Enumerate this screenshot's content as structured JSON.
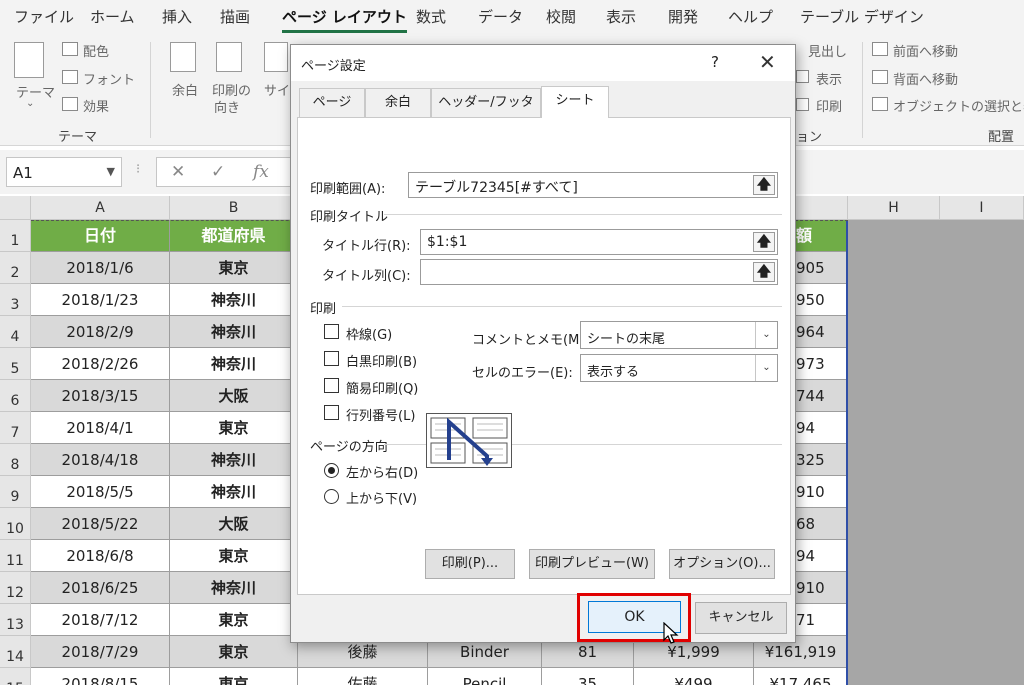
{
  "ribbon_tabs": [
    "ファイル",
    "ホーム",
    "挿入",
    "描画",
    "ページ レイアウト",
    "数式",
    "データ",
    "校閲",
    "表示",
    "開発",
    "ヘルプ",
    "テーブル デザイン"
  ],
  "active_tab_index": 4,
  "ribbon": {
    "theme_btn": "テーマ",
    "colors": "配色",
    "fonts": "フォント",
    "effects": "効果",
    "theme_group": "テーマ",
    "margins": "余白",
    "orientation_1": "印刷の",
    "orientation_2": "向き",
    "size": "サイズ",
    "headings": "見出し",
    "view": "表示",
    "print": "印刷",
    "sheet_options_group": "ョン",
    "bring_forward": "前面へ移動",
    "send_backward": "背面へ移動",
    "selection_pane": "オブジェクトの選択と表示",
    "arrange_group": "配置"
  },
  "formula_bar": {
    "name_box": "A1",
    "fx": "fx",
    "cancel": "✕",
    "enter": "✓"
  },
  "columns": [
    "A",
    "B",
    "H",
    "I"
  ],
  "rows": [
    "1",
    "2",
    "3",
    "4",
    "5",
    "6",
    "7",
    "8",
    "9",
    "10",
    "11",
    "12",
    "13",
    "14",
    "15"
  ],
  "table": {
    "headers": [
      "日付",
      "都道府県"
    ],
    "header_tail": "額",
    "dates": [
      "2018/1/6",
      "2018/1/23",
      "2018/2/9",
      "2018/2/26",
      "2018/3/15",
      "2018/4/1",
      "2018/4/18",
      "2018/5/5",
      "2018/5/22",
      "2018/6/8",
      "2018/6/25",
      "2018/7/12",
      "2018/7/29",
      "2018/8/15"
    ],
    "prefectures": [
      "東京",
      "神奈川",
      "神奈川",
      "神奈川",
      "大阪",
      "東京",
      "神奈川",
      "神奈川",
      "大阪",
      "東京",
      "神奈川",
      "東京",
      "東京",
      "東京"
    ],
    "amount_tails": [
      "905",
      "950",
      "964",
      "973",
      "744",
      "94",
      "325",
      "910",
      "68",
      "94",
      "910",
      "71"
    ],
    "row14": {
      "name": "後藤",
      "item": "Binder",
      "qty": "81",
      "price": "¥1,999",
      "amount": "¥161,919"
    },
    "row15": {
      "name": "佐藤",
      "item": "Pencil",
      "qty": "35",
      "price": "¥499",
      "amount": "¥17,465"
    }
  },
  "dialog": {
    "title": "ページ設定",
    "help": "?",
    "close": "✕",
    "tabs": [
      "ページ",
      "余白",
      "ヘッダー/フッター",
      "シート"
    ],
    "print_area_label": "印刷範囲(A):",
    "print_area_value": "テーブル72345[#すべて]",
    "print_titles_section": "印刷タイトル",
    "title_rows_label": "タイトル行(R):",
    "title_rows_value": "$1:$1",
    "title_cols_label": "タイトル列(C):",
    "title_cols_value": "",
    "print_section": "印刷",
    "gridlines": "枠線(G)",
    "black_white": "白黒印刷(B)",
    "draft": "簡易印刷(Q)",
    "row_col_headings": "行列番号(L)",
    "comments_label": "コメントとメモ(M):",
    "comments_value": "シートの末尾",
    "errors_label": "セルのエラー(E):",
    "errors_value": "表示する",
    "page_order_section": "ページの方向",
    "left_to_right": "左から右(D)",
    "top_to_bottom": "上から下(V)",
    "print_btn": "印刷(P)...",
    "preview_btn": "印刷プレビュー(W)",
    "options_btn": "オプション(O)...",
    "ok_btn": "OK",
    "cancel_btn": "キャンセル"
  }
}
